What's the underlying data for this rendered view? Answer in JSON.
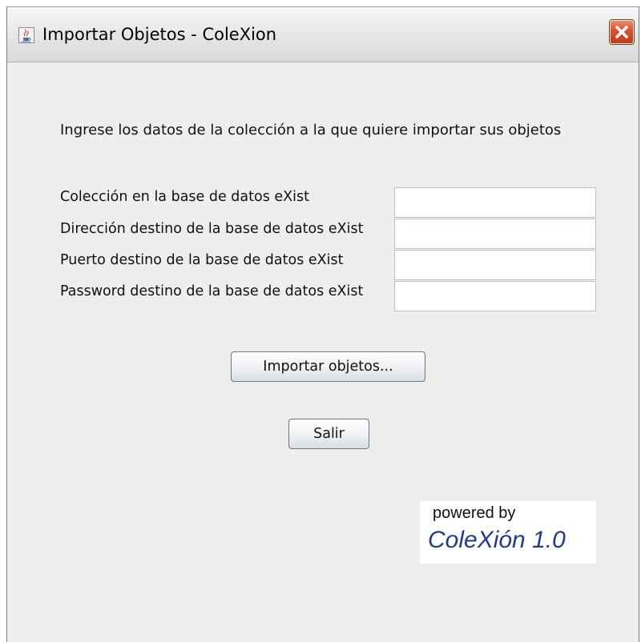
{
  "window": {
    "title": "Importar Objetos - ColeXion",
    "app_icon": "java-cup-icon",
    "close_icon": "close-x-icon",
    "close_color": "#d8522e"
  },
  "form": {
    "instructions": "Ingrese los datos de la colección a la que quiere importar sus objetos",
    "fields": [
      {
        "label": "Colección en la base de datos eXist",
        "value": ""
      },
      {
        "label": "Dirección destino de la base de datos eXist",
        "value": ""
      },
      {
        "label": "Puerto destino de la base de datos eXist",
        "value": ""
      },
      {
        "label": "Password destino de la base de datos eXist",
        "value": ""
      }
    ]
  },
  "buttons": {
    "import_label": "Importar objetos...",
    "exit_label": "Salir"
  },
  "logo": {
    "powered_by": "powered by",
    "name": "ColeXión 1.0",
    "name_color": "#1f3a93"
  }
}
